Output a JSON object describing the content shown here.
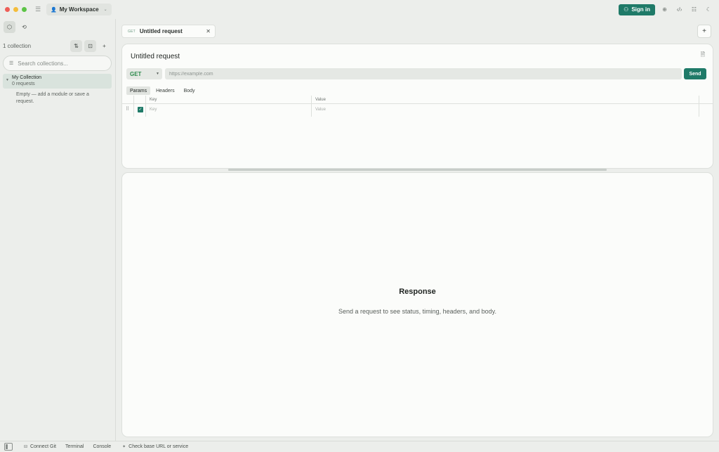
{
  "titlebar": {
    "workspace": "My Workspace",
    "sign_in": "Sign in",
    "icons": [
      "globe-icon",
      "code-icon",
      "list-icon",
      "moon-icon"
    ]
  },
  "sidebar": {
    "collection_count": "1 collection",
    "search_placeholder": "Search collections...",
    "collection": {
      "name": "My Collection",
      "subtitle": "0 requests",
      "empty_text": "Empty — add a module or save a request."
    }
  },
  "tab": {
    "method": "GET",
    "title": "Untitled request"
  },
  "request": {
    "title": "Untitled request",
    "method": "GET",
    "url_placeholder": "https://example.com",
    "send_label": "Send",
    "sub_tabs": [
      "Params",
      "Headers",
      "Body"
    ],
    "params": {
      "headers": [
        "Key",
        "Value"
      ],
      "placeholder_key": "Key",
      "placeholder_value": "Value"
    }
  },
  "response": {
    "title": "Response",
    "subtitle": "Send a request to see status, timing, headers, and body."
  },
  "statusbar": {
    "connect_git": "Connect Git",
    "terminal": "Terminal",
    "console": "Console",
    "check": "Check base URL or service"
  },
  "colors": {
    "accent": "#1f7a68",
    "method_get": "#2e8b4d"
  }
}
